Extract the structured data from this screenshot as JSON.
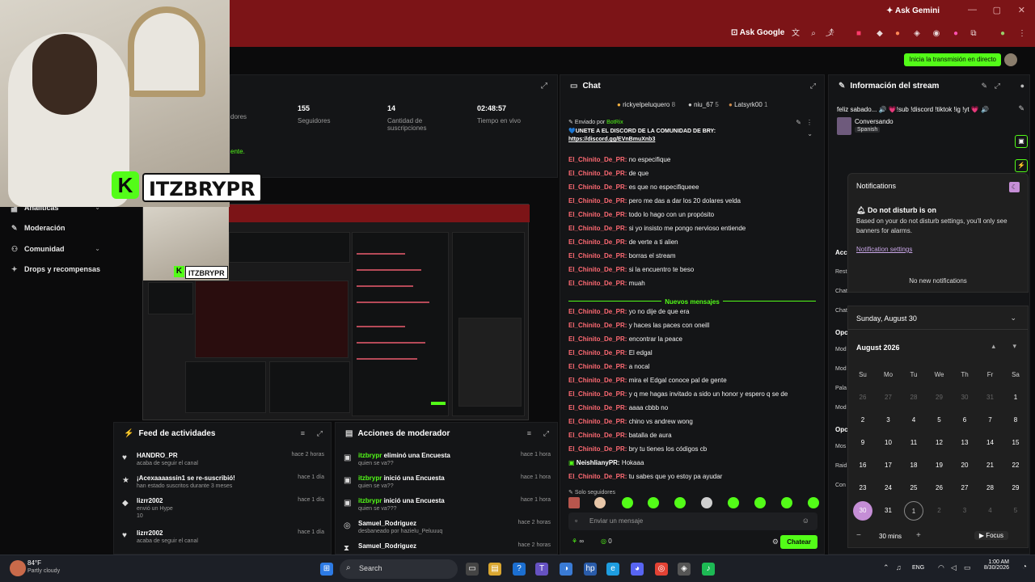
{
  "browser": {
    "gemini": "Ask Gemini",
    "ask_google": "Ask Google",
    "start_stream": "Inicia la transmisión en directo"
  },
  "cam_logo": {
    "k": "K",
    "name": "ITZBRYPR"
  },
  "stats": {
    "items": [
      {
        "value": "",
        "label": "dores"
      },
      {
        "value": "155",
        "label": "Seguidores"
      },
      {
        "value": "14",
        "label": "Cantidad de suscripciones"
      },
      {
        "value": "02:48:57",
        "label": "Tiempo en vivo"
      }
    ],
    "green_text": "ente."
  },
  "sidebar": {
    "items": [
      {
        "label": "Analíticas",
        "icon": "chart-icon"
      },
      {
        "label": "Moderación",
        "icon": "wrench-icon"
      },
      {
        "label": "Comunidad",
        "icon": "person-icon"
      },
      {
        "label": "Drops y recompensas",
        "icon": "gift-icon"
      }
    ]
  },
  "feed": {
    "title": "Feed de actividades",
    "rows": [
      {
        "user": "HANDRO_PR",
        "desc": "acaba de seguir el canal",
        "time": "hace 2 horas",
        "icon": "heart-icon"
      },
      {
        "user": "¡Acexaaaassin1 se re-suscribió!",
        "desc": "han estado suscritos durante 3 meses",
        "time": "hace 1 día",
        "icon": "star-icon"
      },
      {
        "user": "lizrr2002",
        "desc": "envió un Hype",
        "extra": "10",
        "time": "hace 1 día",
        "icon": "kick-icon"
      },
      {
        "user": "lizrr2002",
        "desc": "acaba de seguir el canal",
        "time": "hace 1 día",
        "icon": "heart-icon"
      }
    ]
  },
  "modlog": {
    "title": "Acciones de moderador",
    "rows": [
      {
        "user": "itzbrypr",
        "action": "eliminó una Encuesta",
        "desc": "quien se va??",
        "time": "hace 1 hora"
      },
      {
        "user": "itzbrypr",
        "action": "inició una Encuesta",
        "desc": "quien se va??",
        "time": "hace 1 hora"
      },
      {
        "user": "itzbrypr",
        "action": "inició una Encuesta",
        "desc": "quien se va???",
        "time": "hace 1 hora"
      },
      {
        "user": "Samuel_Rodriguez",
        "action": "",
        "desc": "desbaneado por hazielu_Peluuuq",
        "time": "hace 2 horas"
      },
      {
        "user": "Samuel_Rodriguez",
        "action": "",
        "desc": "",
        "time": "hace 2 horas"
      }
    ]
  },
  "chat": {
    "title": "Chat",
    "ranks": [
      {
        "name": "rickyelpeluquero",
        "n": "8"
      },
      {
        "name": "niu_67",
        "n": "5"
      },
      {
        "name": "Latsyrk00",
        "n": "1"
      }
    ],
    "pinned": {
      "by_label": "Enviado por",
      "by_user": "BotRix",
      "text": "💙UNETE A EL DISCORD DE LA COMUNIDAD DE BRY:",
      "link": "https://discord.gg/EVnBmuXnb3"
    },
    "messages": [
      {
        "user": "El_Chinito_De_PR:",
        "text": "no especifique"
      },
      {
        "user": "El_Chinito_De_PR:",
        "text": "de que"
      },
      {
        "user": "El_Chinito_De_PR:",
        "text": "es que no especifiqueee"
      },
      {
        "user": "El_Chinito_De_PR:",
        "text": "pero me das a dar los 20 dolares velda"
      },
      {
        "user": "El_Chinito_De_PR:",
        "text": "todo lo hago con un propósito"
      },
      {
        "user": "El_Chinito_De_PR:",
        "text": "si yo insisto me pongo nervioso entiende"
      },
      {
        "user": "El_Chinito_De_PR:",
        "text": "de verte a ti alien"
      },
      {
        "user": "El_Chinito_De_PR:",
        "text": "borras el stream"
      },
      {
        "user": "El_Chinito_De_PR:",
        "text": "si la encuentro te beso"
      },
      {
        "user": "El_Chinito_De_PR:",
        "text": "muah"
      }
    ],
    "new_label": "Nuevos mensajes",
    "messages2": [
      {
        "user": "El_Chinito_De_PR:",
        "text": "yo no dije de que era"
      },
      {
        "user": "El_Chinito_De_PR:",
        "text": "y haces las paces con oneill"
      },
      {
        "user": "El_Chinito_De_PR:",
        "text": "encontrar la peace"
      },
      {
        "user": "El_Chinito_De_PR:",
        "text": "El edgal"
      },
      {
        "user": "El_Chinito_De_PR:",
        "text": "a nocal"
      },
      {
        "user": "El_Chinito_De_PR:",
        "text": "mira el Edgal conoce pal de gente"
      },
      {
        "user": "El_Chinito_De_PR:",
        "text": "y q me hagas invitado a sido un honor y espero q se de"
      },
      {
        "user": "El_Chinito_De_PR:",
        "text": "aaaa cbbb no"
      },
      {
        "user": "El_Chinito_De_PR:",
        "text": "chino vs andrew wong"
      },
      {
        "user": "El_Chinito_De_PR:",
        "text": "batalla de aura"
      },
      {
        "user": "El_Chinito_De_PR:",
        "text": "bry tu tienes los códigos cb"
      },
      {
        "user": "NeishlianyPR:",
        "text": "Hokaaa",
        "green": true
      },
      {
        "user": "El_Chinito_De_PR:",
        "text": "tu sabes que yo estoy pa ayudar"
      }
    ],
    "followers_only": "Solo seguidores",
    "placeholder": "Enviar un mensaje",
    "points": "∞",
    "kicks": "0",
    "send": "Chatear"
  },
  "info": {
    "title": "Información del stream",
    "stream_title": "feliz sabado... 🔊 💗!sub !discord !tiktok !ig !yt 💗 🔊",
    "category": "Conversando",
    "language": "Spanish",
    "left_labels": [
      "Acc",
      "Rest",
      "Chat",
      "Chat",
      "Opc",
      "Mod",
      "Mod",
      "Pala",
      "Mod",
      "Opc",
      "Mos",
      "Raid",
      "Con"
    ]
  },
  "notifications": {
    "title": "Notifications",
    "dnd_title": "Do not disturb is on",
    "dnd_text": "Based on your do not disturb settings, you'll only see banners for alarms.",
    "settings_link": "Notification settings",
    "none": "No new notifications"
  },
  "calendar": {
    "date_header": "Sunday, August 30",
    "month": "August 2026",
    "weekdays": [
      "Su",
      "Mo",
      "Tu",
      "We",
      "Th",
      "Fr",
      "Sa"
    ],
    "weeks": [
      [
        "26",
        "27",
        "28",
        "29",
        "30",
        "31",
        "1"
      ],
      [
        "2",
        "3",
        "4",
        "5",
        "6",
        "7",
        "8"
      ],
      [
        "9",
        "10",
        "11",
        "12",
        "13",
        "14",
        "15"
      ],
      [
        "16",
        "17",
        "18",
        "19",
        "20",
        "21",
        "22"
      ],
      [
        "23",
        "24",
        "25",
        "26",
        "27",
        "28",
        "29"
      ],
      [
        "30",
        "31",
        "1",
        "2",
        "3",
        "4",
        "5"
      ]
    ],
    "today": "30",
    "focus_mins": "30 mins",
    "focus": "Focus"
  },
  "taskbar": {
    "weather_temp": "84°F",
    "weather_desc": "Partly cloudy",
    "search": "Search",
    "lang": "ENG",
    "time": "1:00 AM",
    "date": "8/30/2026"
  },
  "colors": {
    "kick_green": "#53fc18",
    "chat_user": "#ff6a73",
    "browser_red": "#7c1417",
    "today": "#c58ed6"
  }
}
